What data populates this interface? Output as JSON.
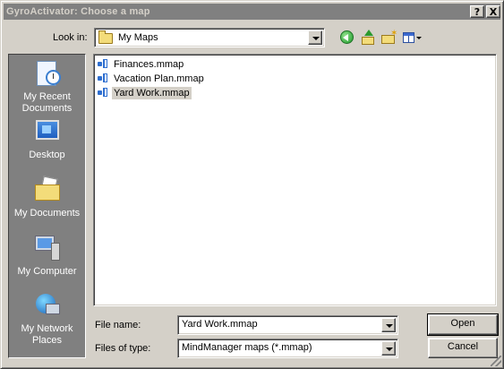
{
  "window": {
    "title": "GyroActivator: Choose a map",
    "help_button": "?",
    "close_button": "X"
  },
  "lookin": {
    "label": "Look in:",
    "value": "My Maps"
  },
  "toolbar": {
    "icons": [
      "back-icon",
      "up-folder-icon",
      "new-folder-icon",
      "views-menu-icon"
    ]
  },
  "places": [
    {
      "label": "My Recent Documents",
      "icon": "recent-documents-icon"
    },
    {
      "label": "Desktop",
      "icon": "desktop-icon"
    },
    {
      "label": "My Documents",
      "icon": "my-documents-icon"
    },
    {
      "label": "My Computer",
      "icon": "my-computer-icon"
    },
    {
      "label": "My Network Places",
      "icon": "network-places-icon"
    }
  ],
  "files": [
    {
      "name": "Finances.mmap"
    },
    {
      "name": "Vacation Plan.mmap"
    },
    {
      "name": "Yard Work.mmap",
      "selected": true
    }
  ],
  "filename": {
    "label": "File name:",
    "value": "Yard Work.mmap"
  },
  "filetype": {
    "label": "Files of type:",
    "value": "MindManager maps (*.mmap)"
  },
  "buttons": {
    "open": "Open",
    "cancel": "Cancel"
  }
}
